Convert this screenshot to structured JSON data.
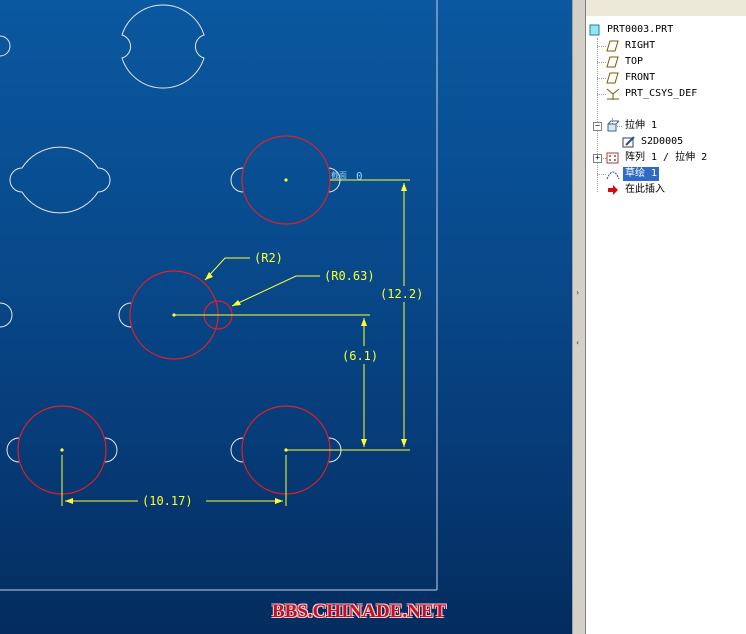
{
  "dimensions": {
    "r2": "(R2)",
    "r063": "(R0.63)",
    "d122": "(12.2)",
    "d61": "(6.1)",
    "d1017": "(10.17)",
    "section_label": "截面",
    "section_value": "0"
  },
  "watermark": "BBS.CHINADE.NET",
  "model_tree": {
    "items": [
      {
        "label": "PRT0003.PRT",
        "icon": "part-icon"
      },
      {
        "label": "RIGHT",
        "icon": "datum-plane-icon"
      },
      {
        "label": "TOP",
        "icon": "datum-plane-icon"
      },
      {
        "label": "FRONT",
        "icon": "datum-plane-icon"
      },
      {
        "label": "PRT_CSYS_DEF",
        "icon": "csys-icon"
      },
      {
        "label": "拉伸 1",
        "icon": "extrude-icon"
      },
      {
        "label": "S2D0005",
        "icon": "sketch-edit-icon"
      },
      {
        "label": "阵列 1 / 拉伸 2",
        "icon": "pattern-icon"
      },
      {
        "label": "草绘 1",
        "icon": "sketch-icon"
      },
      {
        "label": "在此插入",
        "icon": "insert-here-icon"
      }
    ]
  },
  "colors": {
    "viewport_top": "#0a58a0",
    "viewport_bottom": "#042c5e",
    "sketch_red": "#e0202a",
    "dimension_yellow": "#ffff33",
    "geometry_white": "#e8e8e8",
    "selection_blue": "#3169c6"
  }
}
